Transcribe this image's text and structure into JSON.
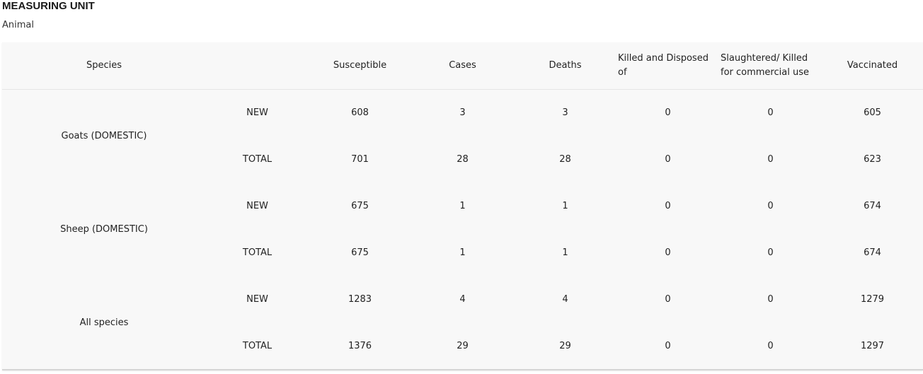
{
  "measuring_unit": {
    "label": "MEASURING UNIT",
    "value": "Animal"
  },
  "table": {
    "headers": {
      "species": "Species",
      "susceptible": "Susceptible",
      "cases": "Cases",
      "deaths": "Deaths",
      "killed": "Killed and Disposed of",
      "slaughtered": "Slaughtered/ Killed for commercial use",
      "vaccinated": "Vaccinated"
    },
    "groups": [
      {
        "species": "Goats (DOMESTIC)",
        "rows": [
          {
            "type": "NEW",
            "susceptible": "608",
            "cases": "3",
            "deaths": "3",
            "killed": "0",
            "slaughtered": "0",
            "vaccinated": "605"
          },
          {
            "type": "TOTAL",
            "susceptible": "701",
            "cases": "28",
            "deaths": "28",
            "killed": "0",
            "slaughtered": "0",
            "vaccinated": "623"
          }
        ]
      },
      {
        "species": "Sheep (DOMESTIC)",
        "rows": [
          {
            "type": "NEW",
            "susceptible": "675",
            "cases": "1",
            "deaths": "1",
            "killed": "0",
            "slaughtered": "0",
            "vaccinated": "674"
          },
          {
            "type": "TOTAL",
            "susceptible": "675",
            "cases": "1",
            "deaths": "1",
            "killed": "0",
            "slaughtered": "0",
            "vaccinated": "674"
          }
        ]
      },
      {
        "species": "All species",
        "rows": [
          {
            "type": "NEW",
            "susceptible": "1283",
            "cases": "4",
            "deaths": "4",
            "killed": "0",
            "slaughtered": "0",
            "vaccinated": "1279"
          },
          {
            "type": "TOTAL",
            "susceptible": "1376",
            "cases": "29",
            "deaths": "29",
            "killed": "0",
            "slaughtered": "0",
            "vaccinated": "1297"
          }
        ]
      }
    ]
  }
}
